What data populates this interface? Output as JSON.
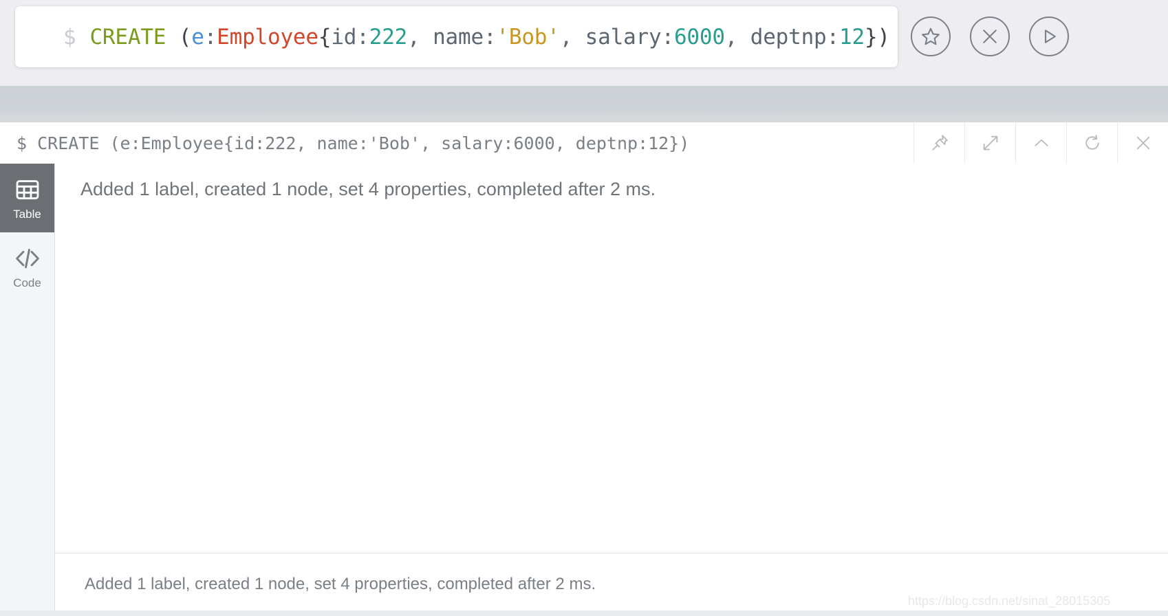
{
  "editor": {
    "prompt": "$",
    "tokens": [
      {
        "text": "CREATE",
        "type": "keyword"
      },
      {
        "text": " (",
        "type": "punct"
      },
      {
        "text": "e",
        "type": "var"
      },
      {
        "text": ":",
        "type": "plain"
      },
      {
        "text": "Employee",
        "type": "label"
      },
      {
        "text": "{",
        "type": "punct"
      },
      {
        "text": "id",
        "type": "plain"
      },
      {
        "text": ":",
        "type": "plain"
      },
      {
        "text": "222",
        "type": "number"
      },
      {
        "text": ", ",
        "type": "plain"
      },
      {
        "text": "name",
        "type": "plain"
      },
      {
        "text": ":",
        "type": "plain"
      },
      {
        "text": "'Bob'",
        "type": "string"
      },
      {
        "text": ", ",
        "type": "plain"
      },
      {
        "text": "salary",
        "type": "plain"
      },
      {
        "text": ":",
        "type": "plain"
      },
      {
        "text": "6000",
        "type": "number"
      },
      {
        "text": ", ",
        "type": "plain"
      },
      {
        "text": "deptnp",
        "type": "plain"
      },
      {
        "text": ":",
        "type": "plain"
      },
      {
        "text": "12",
        "type": "number"
      },
      {
        "text": "})",
        "type": "punct"
      }
    ],
    "raw_query": "CREATE (e:Employee{id:222, name:'Bob', salary:6000, deptnp:12})",
    "buttons": [
      {
        "name": "favorite-button",
        "icon": "star-icon"
      },
      {
        "name": "clear-button",
        "icon": "close-icon"
      },
      {
        "name": "run-button",
        "icon": "play-icon"
      }
    ]
  },
  "result": {
    "header_query": "$ CREATE (e:Employee{id:222, name:'Bob', salary:6000, deptnp:12})",
    "tools": [
      {
        "name": "pin-button",
        "icon": "pin-icon"
      },
      {
        "name": "expand-button",
        "icon": "expand-icon"
      },
      {
        "name": "collapse-button",
        "icon": "chevron-up-icon"
      },
      {
        "name": "rerun-button",
        "icon": "refresh-icon"
      },
      {
        "name": "close-button",
        "icon": "close-icon"
      }
    ],
    "sidebar": [
      {
        "label": "Table",
        "icon": "table-icon",
        "active": true
      },
      {
        "label": "Code",
        "icon": "code-icon",
        "active": false
      }
    ],
    "message": "Added 1 label, created 1 node, set 4 properties, completed after 2 ms.",
    "footer_message": "Added 1 label, created 1 node, set 4 properties, completed after 2 ms."
  },
  "watermark": "https://blog.csdn.net/sinat_28015305",
  "colors": {
    "editor_bg": "#eeeef2",
    "band": "#ced3d7",
    "keyword": "#7b9b1e",
    "label": "#d0472b",
    "variable": "#4a90d9",
    "number": "#2a9d8f",
    "string": "#ca9520",
    "active_tab": "#6b6f74"
  }
}
